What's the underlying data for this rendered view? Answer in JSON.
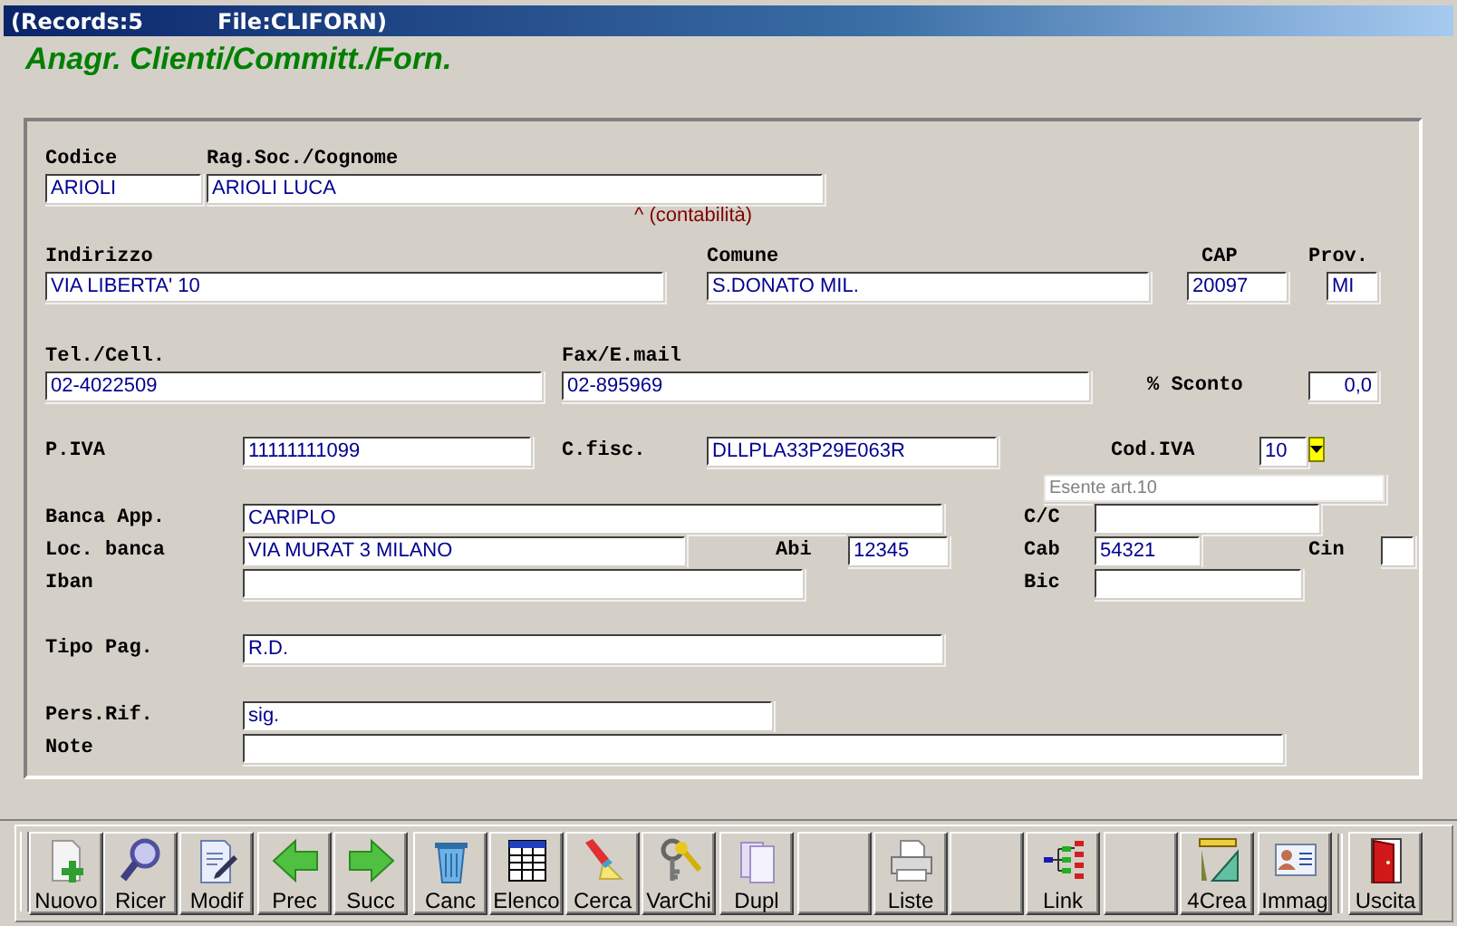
{
  "window": {
    "records": "(Records:5",
    "file": "File:CLIFORN)"
  },
  "title": "Anagr. Clienti/Committ./Forn.",
  "form": {
    "rows": [
      {
        "fields": [
          {
            "label": "Codice",
            "value": "ARIOLI",
            "kind": "text"
          },
          {
            "label": "Rag.Soc./Cognome",
            "value": "ARIOLI LUCA",
            "kind": "text"
          }
        ]
      },
      {
        "note": "^ (contabilità)"
      },
      {
        "fields": [
          {
            "label": "Indirizzo",
            "value": "VIA LIBERTA' 10",
            "kind": "text"
          },
          {
            "label": "Comune",
            "value": "S.DONATO MIL.",
            "kind": "text"
          },
          {
            "label": "CAP",
            "value": "20097",
            "kind": "text"
          },
          {
            "label": "Prov.",
            "value": "MI",
            "kind": "text"
          }
        ]
      },
      {
        "fields": [
          {
            "label": "Tel./Cell.",
            "value": "02-4022509",
            "kind": "text"
          },
          {
            "label": "Fax/E.mail",
            "value": "02-895969",
            "kind": "text"
          },
          {
            "label": "% Sconto",
            "value": "0,0",
            "kind": "number"
          }
        ]
      },
      {
        "fields": [
          {
            "label": "P.IVA",
            "value": "11111111099",
            "kind": "text"
          },
          {
            "label": "C.fisc.",
            "value": "DLLPLA33P29E063R",
            "kind": "text"
          },
          {
            "label": "Cod.IVA",
            "value": "10",
            "kind": "combo"
          }
        ]
      },
      {
        "fields": [
          {
            "value": "Esente art.10",
            "kind": "readonly"
          }
        ]
      },
      {
        "fields": [
          {
            "label": "Banca App.",
            "value": "CARIPLO",
            "kind": "text"
          },
          {
            "label": "C/C",
            "kind": "text"
          }
        ]
      },
      {
        "fields": [
          {
            "label": "Loc. banca",
            "value": "VIA MURAT 3 MILANO",
            "kind": "text"
          },
          {
            "label": "Abi",
            "value": "12345",
            "kind": "text"
          },
          {
            "label": "Cab",
            "value": "54321",
            "kind": "text"
          },
          {
            "label": "Cin",
            "kind": "text"
          }
        ]
      },
      {
        "fields": [
          {
            "label": "Iban",
            "kind": "text"
          },
          {
            "label": "Bic",
            "kind": "text"
          }
        ]
      },
      {
        "fields": [
          {
            "label": "Tipo Pag.",
            "value": "R.D.",
            "kind": "text"
          }
        ]
      },
      {
        "fields": [
          {
            "label": "Pers.Rif.",
            "value": "sig.",
            "kind": "text"
          }
        ]
      },
      {
        "fields": [
          {
            "label": "Note",
            "kind": "text"
          }
        ]
      }
    ]
  },
  "toolbar": [
    {
      "label": "Nuovo",
      "kind": "button"
    },
    {
      "label": "Ricer",
      "kind": "button"
    },
    {
      "label": "Modif",
      "kind": "button"
    },
    {
      "label": "Prec",
      "kind": "button"
    },
    {
      "label": "Succ",
      "kind": "button"
    },
    {
      "label": "Canc",
      "kind": "button"
    },
    {
      "label": "Elenco",
      "kind": "button"
    },
    {
      "label": "Cerca",
      "kind": "button"
    },
    {
      "label": "VarChi",
      "kind": "button"
    },
    {
      "label": "Dupl",
      "kind": "button"
    },
    {
      "kind": "blank"
    },
    {
      "label": "Liste",
      "kind": "button"
    },
    {
      "kind": "blank"
    },
    {
      "label": "Link",
      "kind": "button"
    },
    {
      "kind": "blank"
    },
    {
      "label": "4Crea",
      "kind": "button"
    },
    {
      "label": "Immag",
      "kind": "button"
    },
    {
      "label": "Uscita",
      "kind": "button"
    }
  ]
}
